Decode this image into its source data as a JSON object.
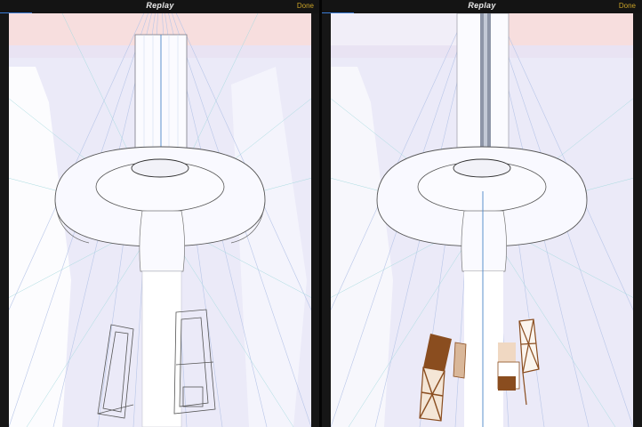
{
  "panels": [
    {
      "id": "left",
      "title": "Replay",
      "done_label": "Done",
      "progress": 0.1
    },
    {
      "id": "right",
      "title": "Replay",
      "done_label": "Done",
      "progress": 0.1
    }
  ],
  "colors": {
    "topbar": "#141414",
    "done": "#c9a227",
    "progress": "#3a7bd5",
    "canvas_bg": "#ebeaf8",
    "sky_band": "#f7dede",
    "wood": "#8a4d1f"
  }
}
